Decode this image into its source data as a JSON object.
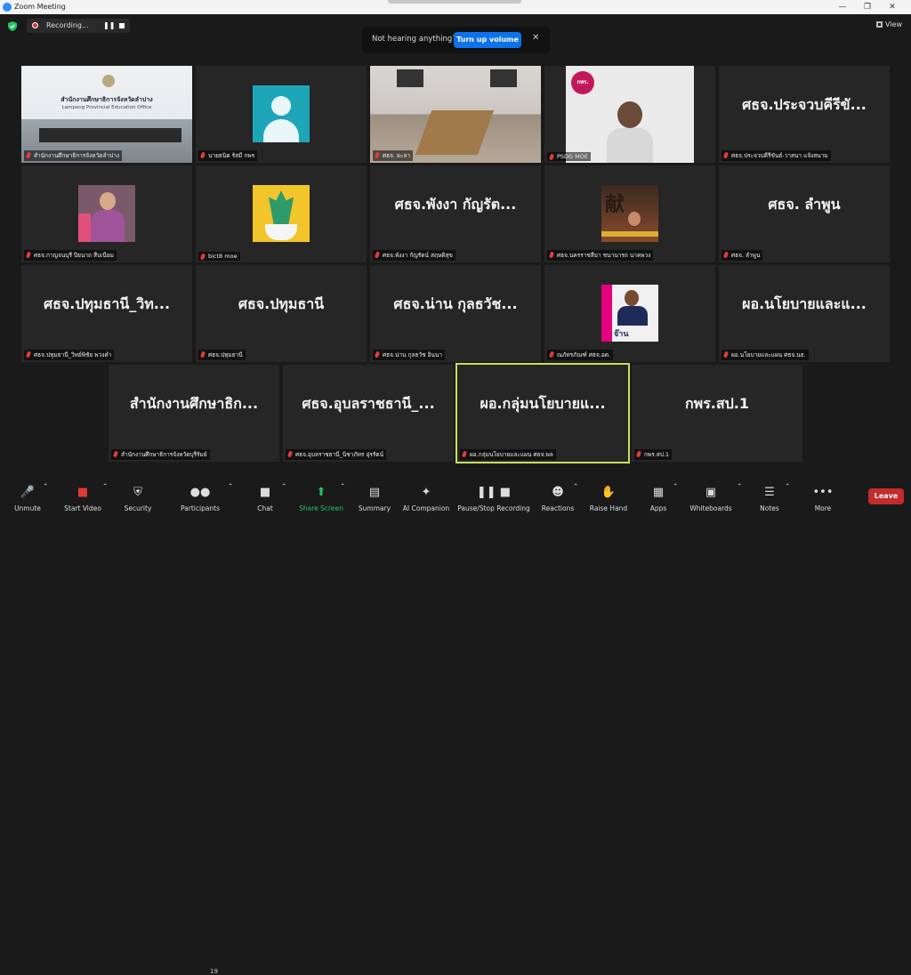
{
  "window": {
    "title": "Zoom Meeting",
    "controls": [
      "minimize-icon",
      "restore-icon",
      "close-icon"
    ]
  },
  "recording": {
    "label": "Recording..."
  },
  "notice": {
    "text": "Not hearing anything?",
    "button": "Turn up volume"
  },
  "view_button": {
    "label": "View"
  },
  "tiles": [
    {
      "name": "สำนักงานศึกษาธิการจังหวัดลำปาง",
      "display": ""
    },
    {
      "name": "นายธนิต รัสมี กพร",
      "display": ""
    },
    {
      "name": "ศธจ. ยะลา",
      "display": ""
    },
    {
      "name": "PSDG MOE",
      "display": ""
    },
    {
      "name": "ศธจ.ประจวบคีรีขันธ์-วาสนา แจ้งสนาม",
      "display": "ศธจ.ประจวบคีรีขั..."
    },
    {
      "name": "ศธจ.กาญจนบุรี ปิยนาถ สืบเนียม",
      "display": ""
    },
    {
      "name": "bict8 moe",
      "display": ""
    },
    {
      "name": "ศธจ.พังงา กัญรัตน์ สฤษดิสุข",
      "display": "ศธจ.พังงา กัญรัต..."
    },
    {
      "name": "ศธจ.นครราชสีมา ชนานารถ นาคพวง",
      "display": ""
    },
    {
      "name": "ศธจ. ลำพูน",
      "display": "ศธจ. ลำพูน"
    },
    {
      "name": "ศธจ.ปทุมธานี_วิทย์พิชัย พวงคำ",
      "display": "ศธจ.ปทุมธานี_วิท..."
    },
    {
      "name": "ศธจ.ปทุมธานี",
      "display": "ศธจ.ปทุมธานี"
    },
    {
      "name": "ศธจ.น่าน กุลธวัช อินนา",
      "display": "ศธจ.น่าน กุลธวัช..."
    },
    {
      "name": "ณภัทรภัณฑ์ ศธจ.อด.",
      "display": ""
    },
    {
      "name": "ผอ.นโยบายและแผน ศธจ.นธ.",
      "display": "ผอ.นโยบายและแ..."
    },
    {
      "name": "สำนักงานศึกษาธิการจังหวัดบุรีรัมย์",
      "display": "สำนักงานศึกษาธิก..."
    },
    {
      "name": "ศธจ.อุบลราชธานี_นิชาภัทร อุ่รรัตน์",
      "display": "ศธจ.อุบลราชธานี_..."
    },
    {
      "name": "ผอ.กลุ่มนโยบายและแผน ศธจ.พล",
      "display": "ผอ.กลุ่มนโยบายแ..."
    },
    {
      "name": "กพร.สป.1",
      "display": "กพร.สป.1"
    }
  ],
  "tile_images": {
    "t0_sign": "สำนักงานศึกษาธิการจังหวัดลำปาง",
    "t0_sign_en": "Lampang Provincial Education Office",
    "t3_sign": "กพร.",
    "t13_sign": "จ๊าน"
  },
  "toolbar": [
    {
      "label": "Unmute",
      "icon": "mic-muted-icon"
    },
    {
      "label": "Start Video",
      "icon": "video-off-icon"
    },
    {
      "label": "Security",
      "icon": "shield-icon"
    },
    {
      "label": "Participants",
      "icon": "participants-icon",
      "count": "19"
    },
    {
      "label": "Chat",
      "icon": "chat-icon"
    },
    {
      "label": "Share Screen",
      "icon": "share-screen-icon"
    },
    {
      "label": "Summary",
      "icon": "summary-icon"
    },
    {
      "label": "AI Companion",
      "icon": "ai-sparkle-icon"
    },
    {
      "label": "Pause/Stop Recording",
      "icon": "pause-stop-icon"
    },
    {
      "label": "Reactions",
      "icon": "reactions-icon"
    },
    {
      "label": "Raise Hand",
      "icon": "hand-icon"
    },
    {
      "label": "Apps",
      "icon": "apps-icon"
    },
    {
      "label": "Whiteboards",
      "icon": "whiteboard-icon"
    },
    {
      "label": "Notes",
      "icon": "notes-icon"
    },
    {
      "label": "More",
      "icon": "more-icon"
    }
  ],
  "leave_button": {
    "label": "Leave"
  },
  "colors": {
    "accent": "#0e72ed",
    "share": "#22c55e",
    "leave": "#c42b2b",
    "active_speaker": "#c8e05a"
  }
}
